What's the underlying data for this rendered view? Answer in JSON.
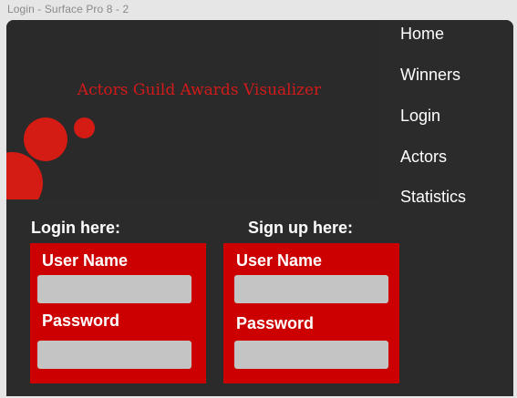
{
  "canvas": {
    "frame_label": "Login - Surface Pro 8 - 2"
  },
  "hero": {
    "title": "Actors Guild Awards Visualizer"
  },
  "nav": {
    "items": [
      "Home",
      "Winners",
      "Login",
      "Actors",
      "Statistics"
    ]
  },
  "login": {
    "heading": "Login here:",
    "username_label": "User Name",
    "username_value": "",
    "password_label": "Password",
    "password_value": ""
  },
  "signup": {
    "heading": "Sign up here:",
    "username_label": "User Name",
    "username_value": "",
    "password_label": "Password",
    "password_value": ""
  },
  "colors": {
    "accent": "#cc0000",
    "hero_title": "#d11a1a",
    "background": "#2b2b2b",
    "input": "#c4c4c4"
  }
}
